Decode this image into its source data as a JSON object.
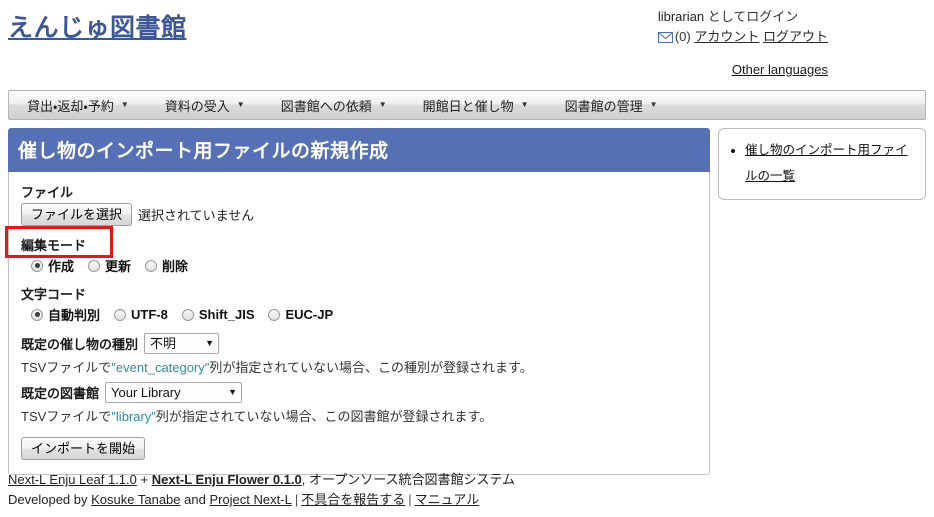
{
  "site": {
    "title": "えんじゅ図書館"
  },
  "user_bar": {
    "logged_in_as_name": "librarian",
    "logged_in_as_suffix": " としてログイン",
    "mail_icon": "envelope-icon",
    "message_count": "(0)",
    "account_label": "アカウント",
    "logout_label": "ログアウト",
    "other_languages_label": "Other languages"
  },
  "nav": {
    "items": [
      {
        "label": "貸出・返却・予約",
        "caret": "▼"
      },
      {
        "label": "資料の受入",
        "caret": "▼"
      },
      {
        "label": "図書館への依頼",
        "caret": "▼"
      },
      {
        "label": "開館日と催し物",
        "caret": "▼"
      },
      {
        "label": "図書館の管理",
        "caret": "▼"
      }
    ]
  },
  "page": {
    "title": "催し物のインポート用ファイルの新規作成"
  },
  "form": {
    "file": {
      "label": "ファイル",
      "button_label": "ファイルを選択",
      "status_text": "選択されていません"
    },
    "edit_mode": {
      "label": "編集モード",
      "options": [
        {
          "label": "作成",
          "checked": true
        },
        {
          "label": "更新",
          "checked": false
        },
        {
          "label": "削除",
          "checked": false
        }
      ]
    },
    "encoding": {
      "label": "文字コード",
      "options": [
        {
          "label": "自動判別",
          "checked": true
        },
        {
          "label": "UTF-8",
          "checked": false
        },
        {
          "label": "Shift_JIS",
          "checked": false
        },
        {
          "label": "EUC-JP",
          "checked": false
        }
      ]
    },
    "default_event_category": {
      "label": "既定の催し物の種別",
      "selected": "不明",
      "arrow": "▼",
      "hint_prefix": "TSVファイルで",
      "hint_code": "\"event_category\"",
      "hint_suffix": "列が指定されていない場合、この種別が登録されます。"
    },
    "default_library": {
      "label": "既定の図書館",
      "selected": "Your Library",
      "arrow": "▼",
      "hint_prefix": "TSVファイルで",
      "hint_code": "\"library\"",
      "hint_suffix": "列が指定されていない場合、この図書館が登録されます。"
    },
    "submit": {
      "label": "インポートを開始"
    }
  },
  "sidebar": {
    "items": [
      {
        "label": "催し物のインポート用ファイルの一覧"
      }
    ]
  },
  "footer": {
    "leaf_label": "Next-L Enju Leaf 1.1.0",
    "plus": " + ",
    "flower_label": "Next-L Enju Flower 0.1.0",
    "system_desc": ", オープンソース統合図書館システム",
    "developed_by": "Developed by ",
    "author": "Kosuke Tanabe",
    "and": " and ",
    "project": "Project Next-L",
    "sep": "|",
    "bug_report": "不具合を報告する",
    "manual": "マニュアル"
  },
  "colors": {
    "title_bar": "#5570b5",
    "highlight": "#e81515",
    "link": "#3b5998",
    "code": "#2e8b9e"
  }
}
